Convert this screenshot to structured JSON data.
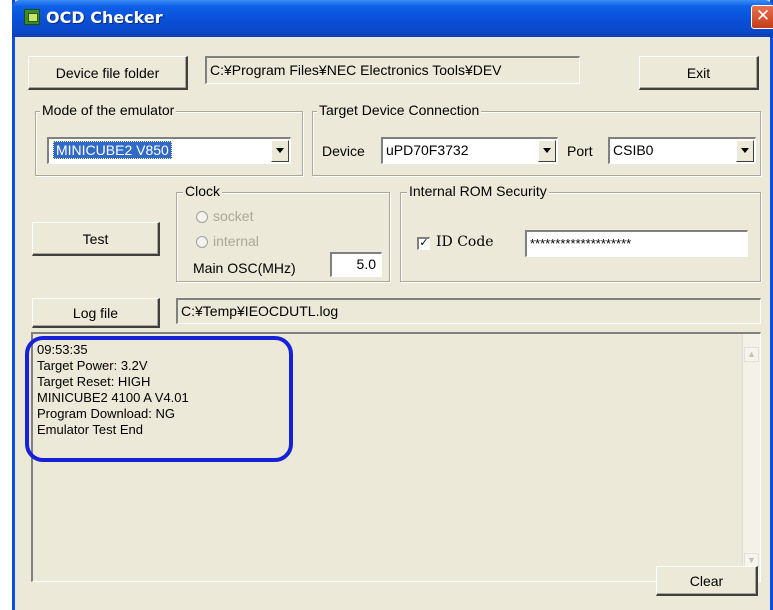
{
  "window": {
    "title": "OCD Checker",
    "close_glyph": "✕"
  },
  "toolbar": {
    "device_folder_button": "Device file folder",
    "device_folder_path": "C:¥Program Files¥NEC Electronics Tools¥DEV",
    "exit_button": "Exit"
  },
  "emulator_mode": {
    "group_label": "Mode of the emulator",
    "selected": "MINICUBE2 V850"
  },
  "target_connection": {
    "group_label": "Target Device Connection",
    "device_label": "Device",
    "device_value": "uPD70F3732",
    "port_label": "Port",
    "port_value": "CSIB0"
  },
  "test_button": "Test",
  "clock": {
    "group_label": "Clock",
    "option_socket": "socket",
    "option_internal": "internal",
    "main_osc_label": "Main OSC(MHz)",
    "main_osc_value": "5.0"
  },
  "rom_security": {
    "group_label": "Internal ROM Security",
    "id_code_label": "ID Code",
    "id_code_checked": true,
    "id_code_value": "********************"
  },
  "log": {
    "button": "Log file",
    "path": "C:¥Temp¥IEOCDUTL.log",
    "lines": [
      "09:53:35",
      "Target Power: 3.2V",
      "Target Reset: HIGH",
      "MINICUBE2 4100 A V4.01",
      "Program Download: NG",
      "Emulator Test End"
    ]
  },
  "clear_button": "Clear",
  "colors": {
    "title_bar": "#0a4fd8",
    "highlight": "#1722d8",
    "face": "#ece9d8",
    "selection": "#316ac5"
  },
  "icons": {
    "app": "app-icon",
    "close": "close-icon",
    "combo": "chevron-down-icon"
  }
}
